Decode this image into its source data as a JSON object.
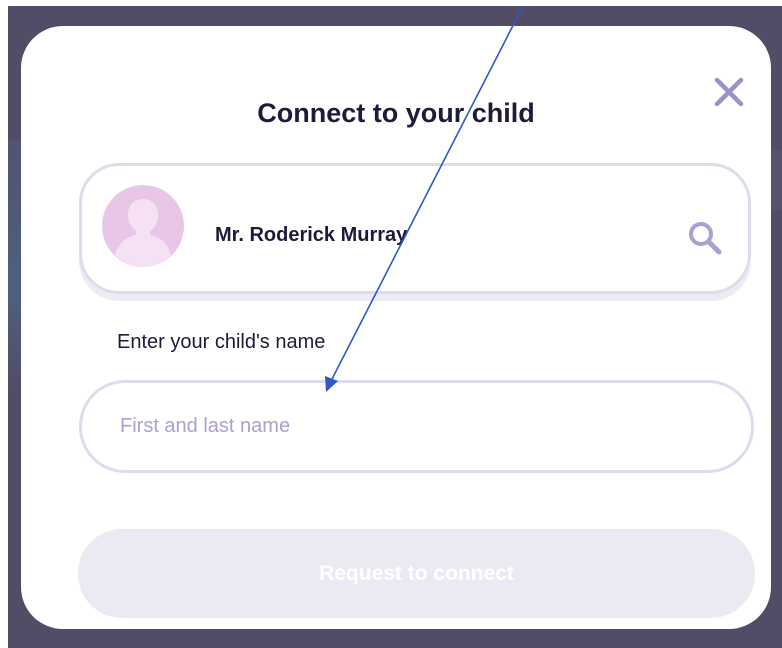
{
  "dialog": {
    "title": "Connect to your child",
    "close_icon": "close-icon"
  },
  "teacher": {
    "name": "Mr. Roderick Murray",
    "avatar_icon": "person-silhouette-icon",
    "search_icon": "search-icon"
  },
  "child_name": {
    "label": "Enter your child's name",
    "value": "",
    "placeholder": "First and last name"
  },
  "request_button": {
    "label": "Request to connect",
    "enabled": false
  },
  "colors": {
    "backdrop": "#534c66",
    "title_text": "#1e1b3a",
    "close_icon": "#9893c7",
    "avatar_bg": "#e8c6e8",
    "field_border": "#dcdcec",
    "placeholder": "#a6a2d2",
    "disabled_button_bg": "#eaeaf3",
    "annotation_arrow": "#2f57c8"
  },
  "annotation": {
    "icon": "annotation-arrow-icon"
  }
}
